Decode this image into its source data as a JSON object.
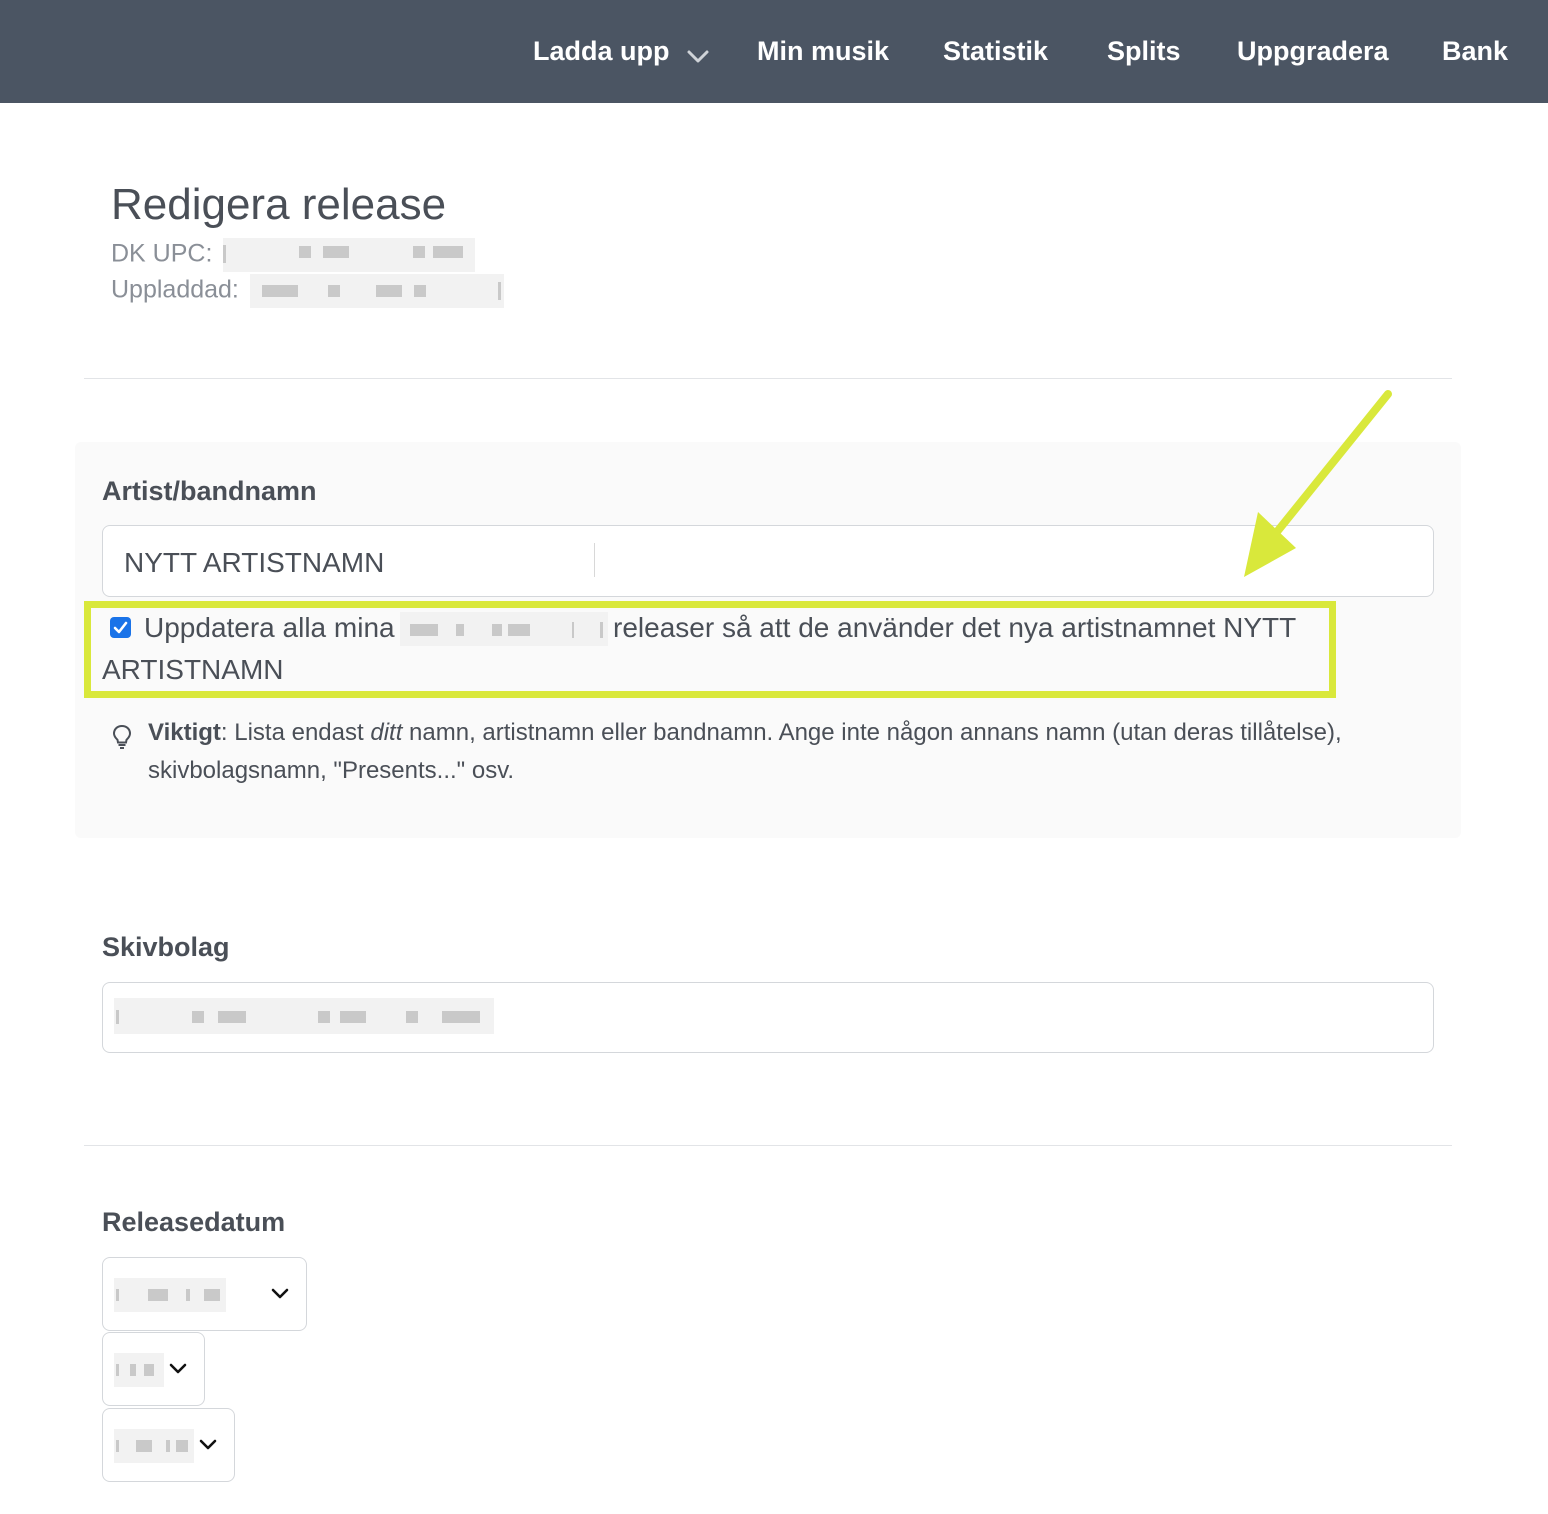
{
  "nav": {
    "upload": "Ladda upp",
    "my_music": "Min musik",
    "stats": "Statistik",
    "splits": "Splits",
    "upgrade": "Uppgradera",
    "bank": "Bank"
  },
  "header": {
    "title": "Redigera release",
    "upc_label": "DK UPC:",
    "uploaded_label": "Uppladdad:"
  },
  "artist": {
    "label": "Artist/bandnamn",
    "value": "NYTT ARTISTNAMN",
    "update_checked": true,
    "update_text_1": "Uppdatera alla mina",
    "update_text_2": "releaser så att de använder det nya artistnamnet NYTT",
    "update_text_3": "ARTISTNAMN",
    "hint_bold": "Viktigt",
    "hint_1": ": Lista endast ",
    "hint_italic": "ditt",
    "hint_2": " namn, artistnamn eller bandnamn. Ange inte någon annans namn (utan deras tillåtelse),",
    "hint_3": "skivbolagsnamn, \"Presents...\" osv."
  },
  "label_section": {
    "label": "Skivbolag"
  },
  "release_date": {
    "label": "Releasedatum"
  },
  "colors": {
    "nav_bg": "#4b5563",
    "highlight": "#d9e83b",
    "checkbox": "#1a73e8"
  },
  "icons": [
    "chevron-down-icon",
    "lightbulb-icon",
    "arrow-annotation"
  ]
}
